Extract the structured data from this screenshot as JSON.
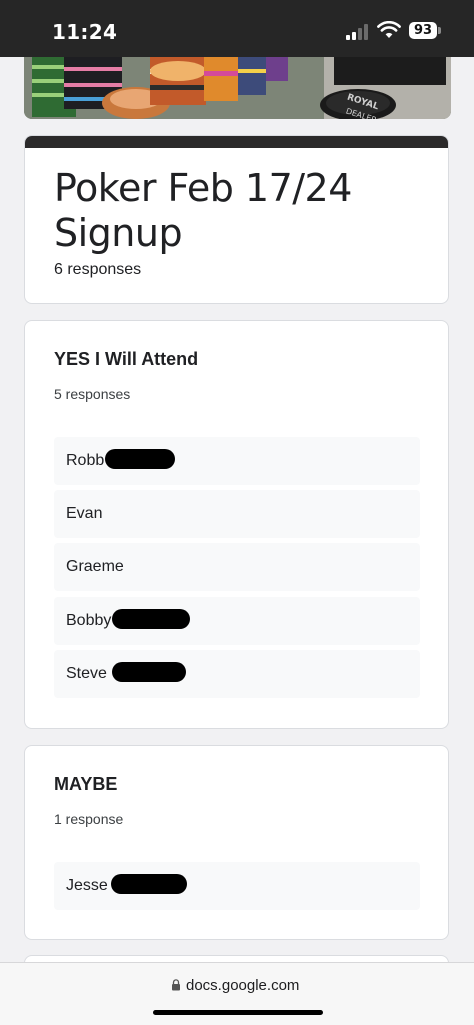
{
  "status_bar": {
    "time": "11:24",
    "battery": "93"
  },
  "form": {
    "title": "Poker Feb 17/24 Signup",
    "responses": "6 responses"
  },
  "questions": [
    {
      "title": "YES I Will Attend",
      "count": "5 responses",
      "answers": [
        "Robb",
        "Evan",
        "Graeme",
        "Bobby",
        "Steve"
      ]
    },
    {
      "title": "MAYBE",
      "count": "1 response",
      "answers": [
        "Jesse"
      ]
    }
  ],
  "browser": {
    "url": "docs.google.com"
  },
  "icons": [
    "signal-icon",
    "wifi-icon",
    "battery-icon",
    "lock-icon"
  ]
}
